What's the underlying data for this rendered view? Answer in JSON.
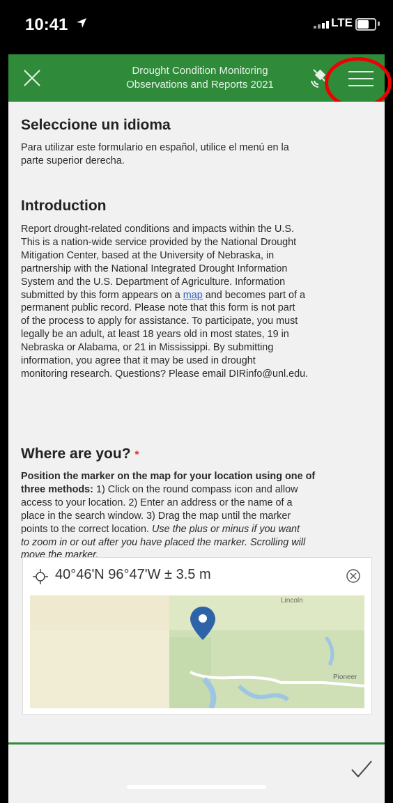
{
  "status_bar": {
    "time": "10:41",
    "network": "LTE"
  },
  "header": {
    "title_line1": "Drought Condition Monitoring",
    "title_line2": "Observations and Reports 2021",
    "close_icon": "close-icon",
    "gps_icon": "satellite-icon",
    "menu_icon": "hamburger-menu-icon",
    "bar_color": "#2f8a3a"
  },
  "language": {
    "heading": "Seleccione un idioma",
    "text_line1": "Para utilizar este formulario en español, utilice el menú en la",
    "text_line2": "parte superior derecha."
  },
  "introduction": {
    "heading": "Introduction",
    "lines": [
      "Report drought-related conditions and impacts within the U.S.",
      "This is a nation-wide service provided by the National Drought",
      "Mitigation Center, based at the University of Nebraska, in",
      "partnership with the National Integrated Drought Information",
      "System and the U.S. Department of Agriculture. Information"
    ],
    "line6_before": "submitted by this form appears on a ",
    "map_link": "map",
    "line6_after": " and becomes part of a",
    "lines_after": [
      "permanent public record. Please note that this form is not part",
      "of the process to apply for assistance. To participate, you must",
      "legally be an adult, at least 18 years old in most states, 19 in",
      "Nebraska or Alabama, or 21 in Mississippi. By submitting",
      "information, you agree that it may be used in drought",
      "monitoring research. Questions? Please email DIRinfo@unl.edu."
    ]
  },
  "location": {
    "heading": "Where are you?",
    "required_mark": "*",
    "bold1": "Position the marker on the map for your location using one of",
    "bold2": "three methods:",
    "l2_rest": " 1) Click on the round compass icon and allow",
    "l3": "access to your location. 2) Enter an address or the name of a",
    "l4": "place in the search window. 3) Drag the map until the marker",
    "l5_a": "points to the correct location. ",
    "l5_b": "Use the plus or minus if you want",
    "l6": "to zoom in or out after you have placed the marker. Scrolling will",
    "l7": "move the marker.",
    "coordinates": "40°46'N 96°47'W ± 3.5 m",
    "map_label_top": "Lincoln",
    "map_label_right": "Pioneer"
  },
  "footer": {
    "submit_icon": "checkmark-icon",
    "accent": "#2f8a3a"
  },
  "annotation_color": "#e00000"
}
